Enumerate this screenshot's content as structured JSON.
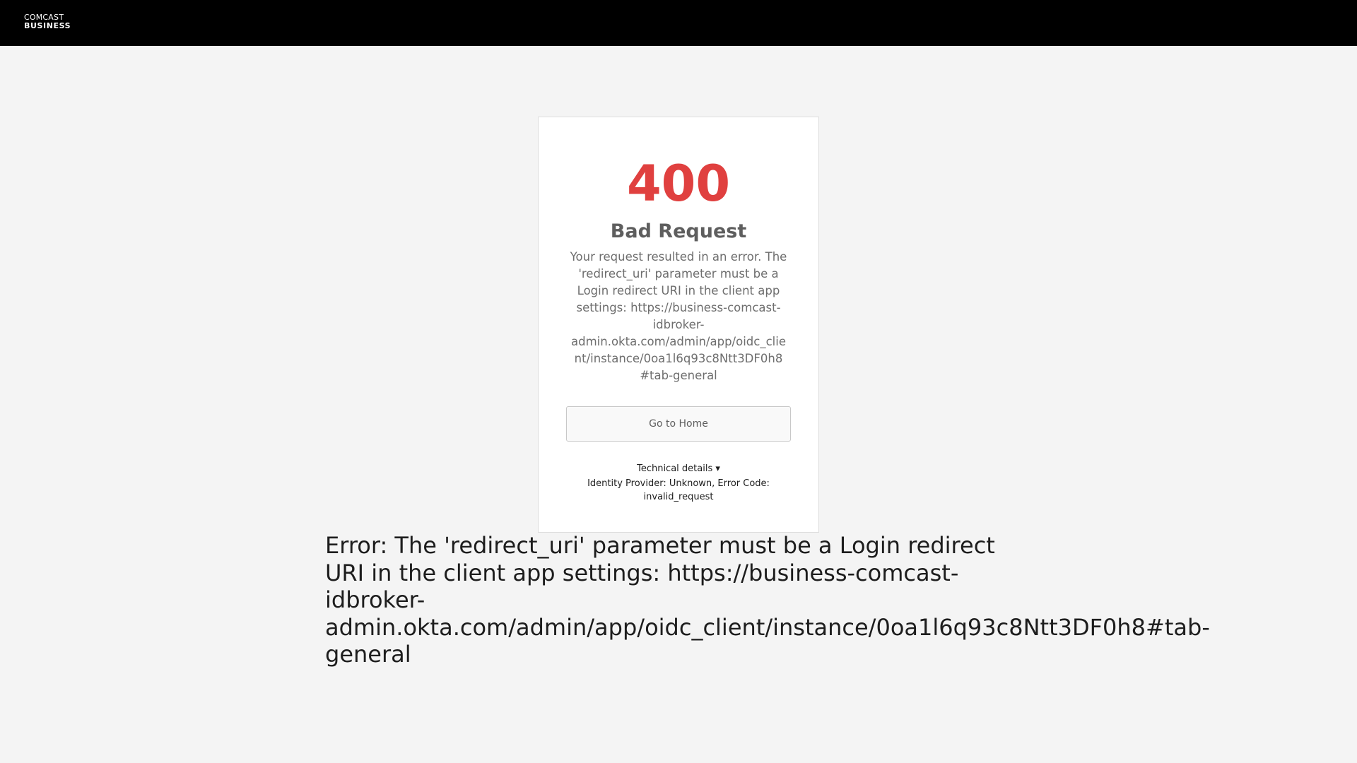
{
  "header": {
    "logo_line1": "COMCAST",
    "logo_line2": "BUSINESS",
    "background_color": "#000000"
  },
  "error_card": {
    "code": "400",
    "title": "Bad Request",
    "description": "Your request resulted in an error. The 'redirect_uri' parameter must be a Login redirect URI in the client app settings: https://business-comcast-idbroker-admin.okta.com/admin/app/oidc_client/instance/0oa1l6q93c8Ntt3DF0h8#tab-general",
    "description_lines": [
      "Your request resulted in an error. The",
      "'redirect_uri' parameter must be a",
      "Login redirect URI in the client app",
      "settings: https://business-comcast-",
      "idbroker-",
      "admin.okta.com/admin/app/oidc_clie",
      "nt/instance/0oa1l6q93c8Ntt3DF0h8",
      "#tab-general"
    ],
    "home_button_label": "Go to Home",
    "technical_details_label": "Technical details ▾",
    "technical_details_lines": [
      "Identity Provider: Unknown, Error Code:",
      "invalid_request"
    ],
    "code_color": "#e0403f"
  },
  "page_error": {
    "lines": [
      "Error: The 'redirect_uri' parameter must be a Login redirect",
      "URI in the client app settings: https://business-comcast-",
      "idbroker-",
      "admin.okta.com/admin/app/oidc_client/instance/0oa1l6q93c8Ntt3DF0h8#tab-",
      "general"
    ]
  }
}
